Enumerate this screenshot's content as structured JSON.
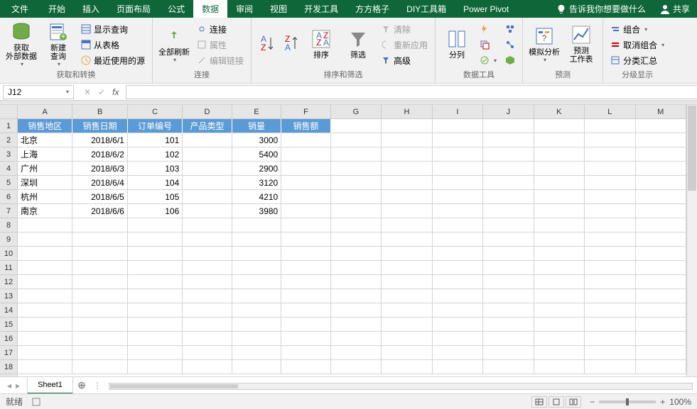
{
  "tabs": {
    "file": "文件",
    "home": "开始",
    "insert": "插入",
    "layout": "页面布局",
    "formula": "公式",
    "data": "数据",
    "review": "审阅",
    "view": "视图",
    "dev": "开发工具",
    "ffgz": "方方格子",
    "diy": "DIY工具箱",
    "pp": "Power Pivot",
    "tell": "告诉我你想要做什么",
    "share": "共享"
  },
  "ribbon": {
    "g1": {
      "label": "获取和转换",
      "btn1": "获取\n外部数据",
      "btn2": "新建\n查询",
      "s1": "显示查询",
      "s2": "从表格",
      "s3": "最近使用的源"
    },
    "g2": {
      "label": "连接",
      "btn": "全部刷新",
      "s1": "连接",
      "s2": "属性",
      "s3": "编辑链接"
    },
    "g3": {
      "label": "排序和筛选",
      "btn1": "排序",
      "btn2": "筛选",
      "s1": "清除",
      "s2": "重新应用",
      "s3": "高级"
    },
    "g4": {
      "label": "数据工具",
      "btn": "分列"
    },
    "g5": {
      "label": "预测",
      "btn1": "模拟分析",
      "btn2": "预测\n工作表"
    },
    "g6": {
      "label": "分级显示",
      "s1": "组合",
      "s2": "取消组合",
      "s3": "分类汇总"
    }
  },
  "namebox": "J12",
  "columns": [
    "A",
    "B",
    "C",
    "D",
    "E",
    "F",
    "G",
    "H",
    "I",
    "J",
    "K",
    "L",
    "M"
  ],
  "rows": [
    "1",
    "2",
    "3",
    "4",
    "5",
    "6",
    "7",
    "8",
    "9",
    "10",
    "11",
    "12",
    "13",
    "14",
    "15",
    "16",
    "17",
    "18"
  ],
  "headers": {
    "A": "销售地区",
    "B": "销售日期",
    "C": "订单编号",
    "D": "产品类型",
    "E": "销量",
    "F": "销售额"
  },
  "chart_data": {
    "type": "table",
    "columns": [
      "销售地区",
      "销售日期",
      "订单编号",
      "产品类型",
      "销量",
      "销售额"
    ],
    "rows": [
      {
        "region": "北京",
        "date": "2018/6/1",
        "order": 101,
        "ptype": "",
        "qty": 3000,
        "amount": ""
      },
      {
        "region": "上海",
        "date": "2018/6/2",
        "order": 102,
        "ptype": "",
        "qty": 5400,
        "amount": ""
      },
      {
        "region": "广州",
        "date": "2018/6/3",
        "order": 103,
        "ptype": "",
        "qty": 2900,
        "amount": ""
      },
      {
        "region": "深圳",
        "date": "2018/6/4",
        "order": 104,
        "ptype": "",
        "qty": 3120,
        "amount": ""
      },
      {
        "region": "杭州",
        "date": "2018/6/5",
        "order": 105,
        "ptype": "",
        "qty": 4210,
        "amount": ""
      },
      {
        "region": "南京",
        "date": "2018/6/6",
        "order": 106,
        "ptype": "",
        "qty": 3980,
        "amount": ""
      }
    ]
  },
  "sheet": "Sheet1",
  "status": "就绪",
  "zoom": "100%"
}
